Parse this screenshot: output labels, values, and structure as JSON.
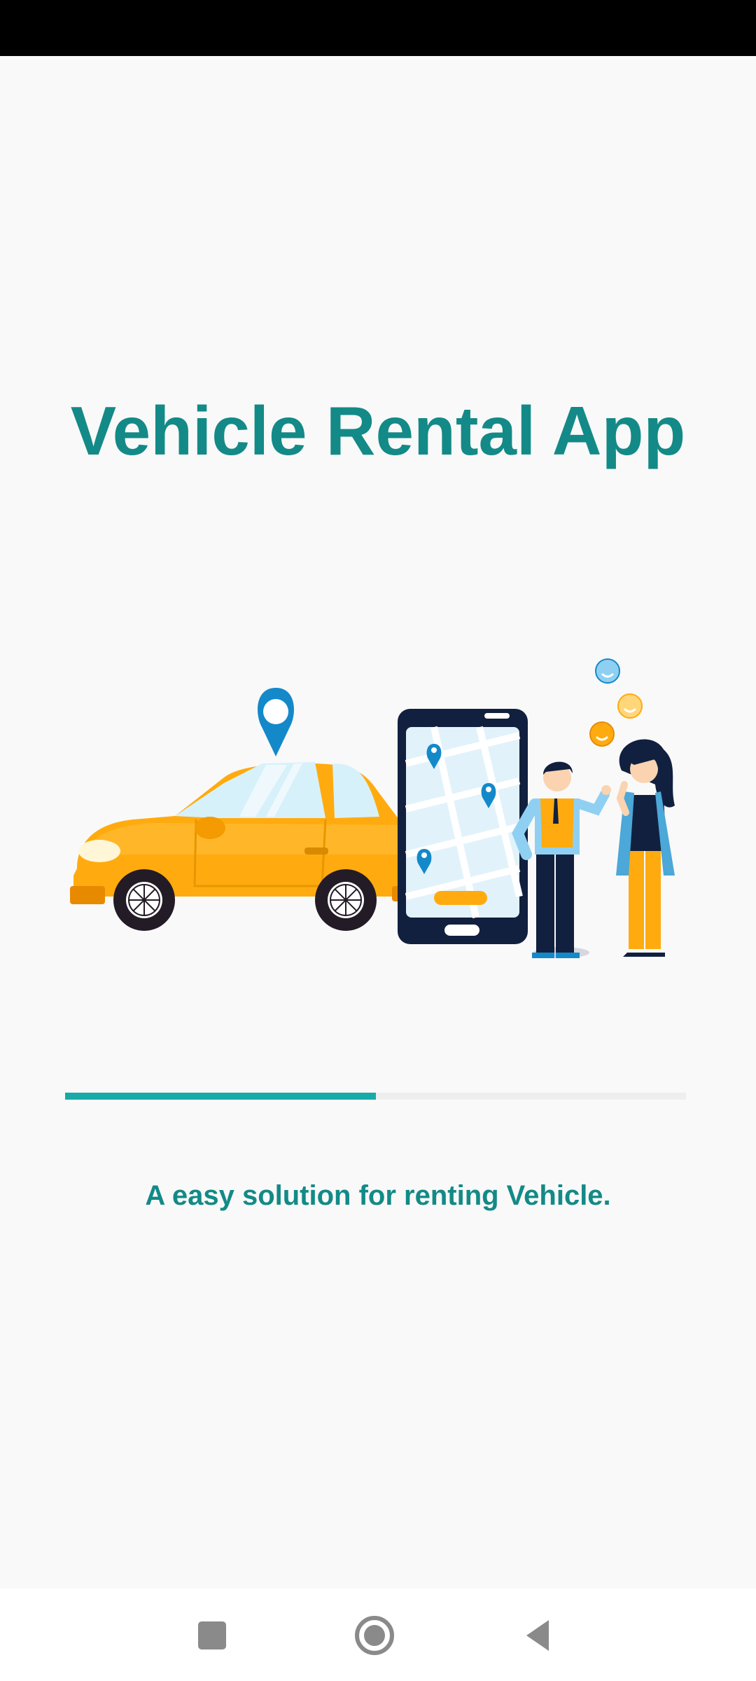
{
  "app": {
    "title": "Vehicle Rental App",
    "tagline": "A easy solution for renting Vehicle."
  },
  "loading": {
    "progress": 0.5
  },
  "theme": {
    "accent": "#138a87",
    "progress_fill": "#17aaa8",
    "car_yellow": "#ffab0f",
    "phone_navy": "#12203f",
    "pin_blue": "#1489c9"
  },
  "nav": {
    "buttons": [
      "recents-icon",
      "home-icon",
      "back-icon"
    ]
  }
}
